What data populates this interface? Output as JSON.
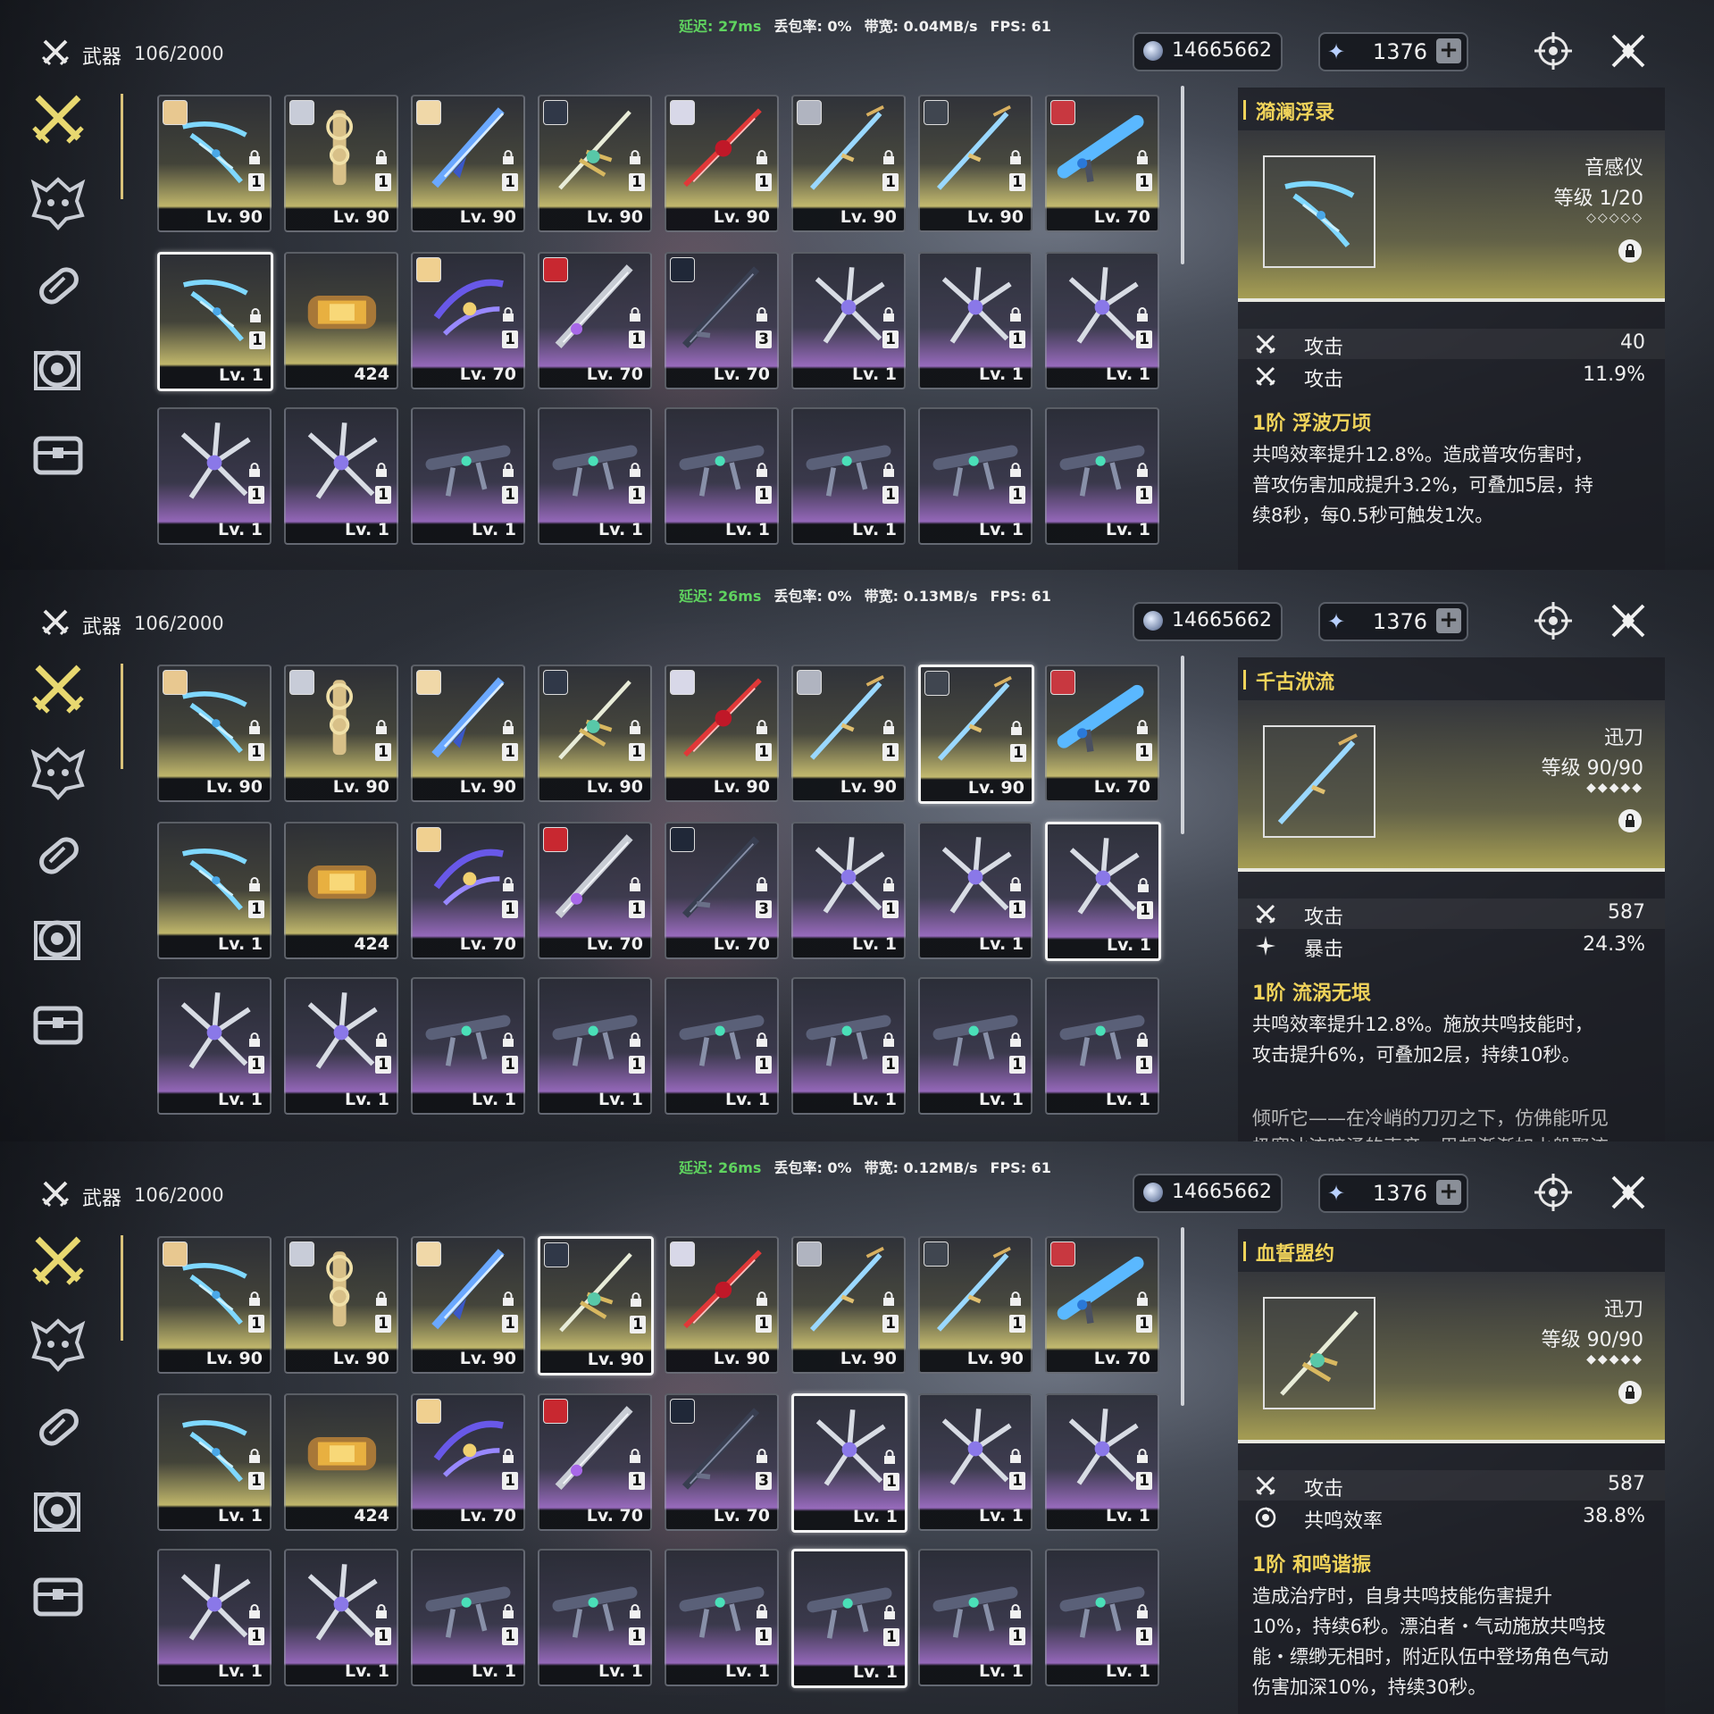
{
  "header": {
    "category_title": "武器",
    "count": "106/2000",
    "currency_coins": "14665662",
    "currency_stars": "1376",
    "plus_label": "+"
  },
  "panels": [
    {
      "stats": {
        "latency": "延迟: 27ms",
        "loss": "丢包率: 0%",
        "bandwidth": "带宽: 0.04MB/s",
        "fps": "FPS: 61"
      },
      "detail": {
        "name": "漪澜浮录",
        "type": "音感仪",
        "level": "等级 1/20",
        "stars": "◇◇◇◇◇",
        "stats": [
          {
            "name": "攻击",
            "value": "40"
          },
          {
            "name": "攻击",
            "value": "11.9%"
          }
        ],
        "passive_title": "1阶 浮波万顷",
        "passive_lines": [
          "共鸣效率提升12.8%。造成普攻伤害时，",
          "普攻伤害加成提升3.2%，可叠加5层，持",
          "续8秒，每0.5秒可触发1次。"
        ],
        "flavor_lines": []
      }
    },
    {
      "stats": {
        "latency": "延迟: 26ms",
        "loss": "丢包率: 0%",
        "bandwidth": "带宽: 0.13MB/s",
        "fps": "FPS: 61"
      },
      "detail": {
        "name": "千古洑流",
        "type": "迅刀",
        "level": "等级 90/90",
        "stars": "◆◆◆◆◆",
        "stats": [
          {
            "name": "攻击",
            "value": "587"
          },
          {
            "name": "暴击",
            "value": "24.3%"
          }
        ],
        "passive_title": "1阶 流涡无垠",
        "passive_lines": [
          "共鸣效率提升12.8%。施放共鸣技能时，",
          "攻击提升6%，可叠加2层，持续10秒。"
        ],
        "flavor_lines": [
          "倾听它——在冷峭的刀刃之下，仿佛能听见",
          "极寒冰流暗涌的声音，思想渐渐如水般聚流"
        ]
      }
    },
    {
      "stats": {
        "latency": "延迟: 26ms",
        "loss": "丢包率: 0%",
        "bandwidth": "带宽: 0.12MB/s",
        "fps": "FPS: 61"
      },
      "detail": {
        "name": "血誓盟约",
        "type": "迅刀",
        "level": "等级 90/90",
        "stars": "◆◆◆◆◆",
        "stats": [
          {
            "name": "攻击",
            "value": "587"
          },
          {
            "name": "共鸣效率",
            "value": "38.8%"
          }
        ],
        "passive_title": "1阶 和鸣谐振",
        "passive_lines": [
          "造成治疗时，自身共鸣技能伤害提升",
          "10%，持续6秒。漂泊者・气动施放共鸣技",
          "能・缥缈无相时，附近队伍中登场角色气动",
          "伤害加深10%，持续30秒。"
        ],
        "flavor_lines": []
      }
    }
  ],
  "rows": [
    [
      {
        "lv": "Lv. 90",
        "cnt": "1",
        "rarity": "gold",
        "w": "bow-blue",
        "av": "#e8c890"
      },
      {
        "lv": "Lv. 90",
        "cnt": "1",
        "rarity": "gold",
        "w": "gold-key",
        "av": "#c8ccd8"
      },
      {
        "lv": "Lv. 90",
        "cnt": "1",
        "rarity": "gold",
        "w": "blue-lance",
        "av": "#f0d8a8"
      },
      {
        "lv": "Lv. 90",
        "cnt": "1",
        "rarity": "gold",
        "w": "gold-sword",
        "av": "#303848"
      },
      {
        "lv": "Lv. 90",
        "cnt": "1",
        "rarity": "gold",
        "w": "red-blade",
        "av": "#d8d8e8"
      },
      {
        "lv": "Lv. 90",
        "cnt": "1",
        "rarity": "gold",
        "w": "ice-sword",
        "av": "#b0b4c0"
      },
      {
        "lv": "Lv. 90",
        "cnt": "1",
        "rarity": "gold",
        "w": "ice-sword",
        "av": "#404650"
      },
      {
        "lv": "Lv. 70",
        "cnt": "1",
        "rarity": "gold",
        "w": "blue-gun",
        "av": "#c83840"
      }
    ],
    [
      {
        "lv": "Lv. 1",
        "cnt": "1",
        "rarity": "gold",
        "w": "bow-blue",
        "av": ""
      },
      {
        "lv": "424",
        "cnt": "",
        "rarity": "gold",
        "w": "canister",
        "av": ""
      },
      {
        "lv": "Lv. 70",
        "cnt": "1",
        "rarity": "purple",
        "w": "purple-claw",
        "av": "#f0d090"
      },
      {
        "lv": "Lv. 70",
        "cnt": "1",
        "rarity": "purple",
        "w": "grey-blade",
        "av": "#c82830"
      },
      {
        "lv": "Lv. 70",
        "cnt": "3",
        "rarity": "purple",
        "w": "dark-katana",
        "av": "#202838"
      },
      {
        "lv": "Lv. 1",
        "cnt": "1",
        "rarity": "purple",
        "w": "silver-claw",
        "av": ""
      },
      {
        "lv": "Lv. 1",
        "cnt": "1",
        "rarity": "purple",
        "w": "silver-claw",
        "av": ""
      },
      {
        "lv": "Lv. 1",
        "cnt": "1",
        "rarity": "purple",
        "w": "silver-claw",
        "av": ""
      }
    ],
    [
      {
        "lv": "Lv. 1",
        "cnt": "1",
        "rarity": "purple",
        "w": "silver-claw",
        "av": ""
      },
      {
        "lv": "Lv. 1",
        "cnt": "1",
        "rarity": "purple",
        "w": "silver-claw",
        "av": ""
      },
      {
        "lv": "Lv. 1",
        "cnt": "1",
        "rarity": "purple",
        "w": "dark-gun",
        "av": ""
      },
      {
        "lv": "Lv. 1",
        "cnt": "1",
        "rarity": "purple",
        "w": "dark-gun",
        "av": ""
      },
      {
        "lv": "Lv. 1",
        "cnt": "1",
        "rarity": "purple",
        "w": "dark-gun",
        "av": ""
      },
      {
        "lv": "Lv. 1",
        "cnt": "1",
        "rarity": "purple",
        "w": "dark-gun",
        "av": ""
      },
      {
        "lv": "Lv. 1",
        "cnt": "1",
        "rarity": "purple",
        "w": "dark-gun",
        "av": ""
      },
      {
        "lv": "Lv. 1",
        "cnt": "1",
        "rarity": "purple",
        "w": "dark-gun",
        "av": ""
      }
    ]
  ],
  "sidebar": {
    "items": [
      {
        "icon": "crossed-swords-icon",
        "active": true
      },
      {
        "icon": "echo-mask-icon",
        "active": false
      },
      {
        "icon": "material-capsule-icon",
        "active": false
      },
      {
        "icon": "development-gear-icon",
        "active": false
      },
      {
        "icon": "chest-icon",
        "active": false
      }
    ]
  },
  "colors": {
    "accent": "#f0d35a",
    "gold_rarity": "#c8be6e",
    "purple_rarity": "#a06ec8",
    "latency_green": "#5fd35f"
  }
}
